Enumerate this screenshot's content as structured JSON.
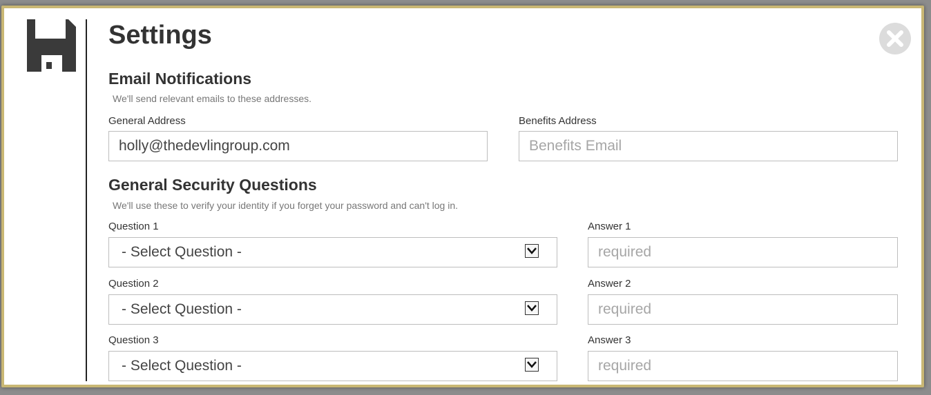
{
  "dialog": {
    "title": "Settings",
    "save_icon": "floppy-disk-icon",
    "close_icon": "close-circle-icon"
  },
  "email_notifications": {
    "heading": "Email Notifications",
    "description": "We'll send relevant emails to these addresses.",
    "general_address": {
      "label": "General Address",
      "value": "holly@thedevlingroup.com"
    },
    "benefits_address": {
      "label": "Benefits Address",
      "value": "",
      "placeholder": "Benefits Email"
    }
  },
  "security_questions": {
    "heading": "General Security Questions",
    "description": "We'll use these to verify your identity if you forget your password and can't log in.",
    "questions": [
      {
        "question_label": "Question 1",
        "selected": "- Select Question -",
        "answer_label": "Answer 1",
        "answer_placeholder": "required"
      },
      {
        "question_label": "Question 2",
        "selected": "- Select Question -",
        "answer_label": "Answer 2",
        "answer_placeholder": "required"
      },
      {
        "question_label": "Question 3",
        "selected": "- Select Question -",
        "answer_label": "Answer 3",
        "answer_placeholder": "required"
      }
    ]
  },
  "colors": {
    "modal_border": "#c9b774",
    "text": "#333333",
    "placeholder": "#a6a6a6"
  }
}
